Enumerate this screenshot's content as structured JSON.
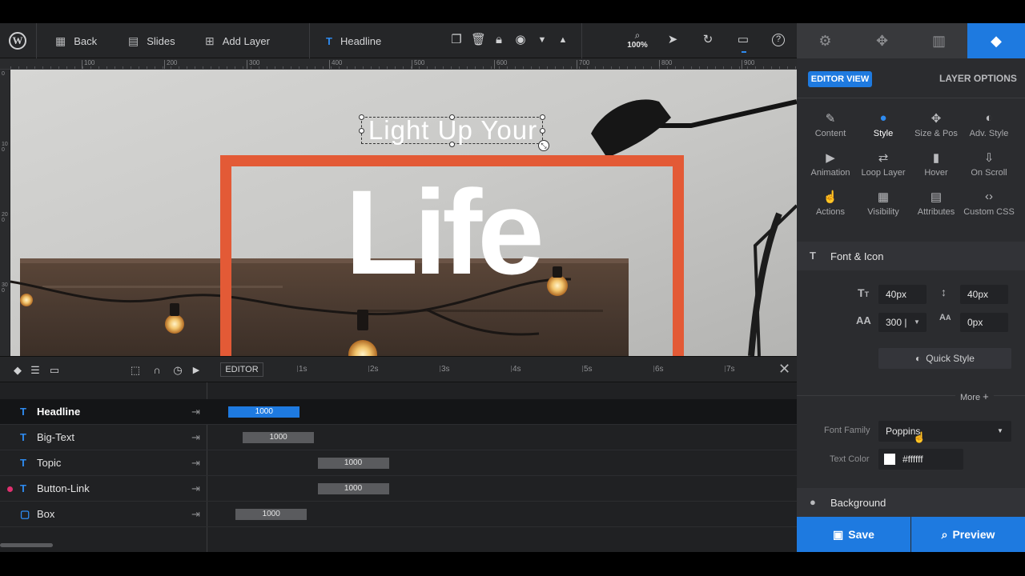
{
  "toolbar": {
    "back_label": "Back",
    "slides_label": "Slides",
    "add_layer_label": "Add Layer",
    "layer_type_glyph": "T",
    "current_layer": "Headline",
    "zoom": "100%"
  },
  "ruler": {
    "ticks": [
      "100",
      "200",
      "300",
      "400",
      "500",
      "600",
      "700",
      "800",
      "900"
    ]
  },
  "vruler": {
    "ticks": [
      "0",
      "100",
      "200",
      "300"
    ]
  },
  "canvas": {
    "headline_text": "Light Up Your",
    "big_text": "Life",
    "accent_color": "#e35a36"
  },
  "timeline": {
    "editor_label": "EDITOR",
    "time_ticks": [
      "1s",
      "2s",
      "3s",
      "4s",
      "5s",
      "6s",
      "7s"
    ],
    "layers": [
      {
        "type_glyph": "T",
        "name": "Headline",
        "duration": "1000",
        "start_s": 0.7,
        "end_s": 1.7,
        "selected": true
      },
      {
        "type_glyph": "T",
        "name": "Big-Text",
        "duration": "1000",
        "start_s": 0.9,
        "end_s": 1.9,
        "selected": false
      },
      {
        "type_glyph": "T",
        "name": "Topic",
        "duration": "1000",
        "start_s": 1.95,
        "end_s": 2.95,
        "selected": false
      },
      {
        "type_glyph": "T",
        "name": "Button-Link",
        "duration": "1000",
        "start_s": 1.95,
        "end_s": 2.95,
        "selected": false,
        "has_action": true
      },
      {
        "type_glyph": "▢",
        "name": "Box",
        "duration": "1000",
        "start_s": 0.8,
        "end_s": 1.8,
        "selected": false
      }
    ]
  },
  "panel": {
    "editor_view_label": "EDITOR VIEW",
    "layer_options_label": "LAYER OPTIONS",
    "options": [
      {
        "label": "Content",
        "icon": "pencil-icon",
        "glyph": "✎",
        "active": false
      },
      {
        "label": "Style",
        "icon": "palette-icon",
        "glyph": "●",
        "active": true
      },
      {
        "label": "Size & Pos",
        "icon": "move-icon",
        "glyph": "✥",
        "active": false
      },
      {
        "label": "Adv. Style",
        "icon": "contrast-icon",
        "glyph": "◐",
        "active": false
      },
      {
        "label": "Animation",
        "icon": "play-icon",
        "glyph": "▶",
        "active": false
      },
      {
        "label": "Loop Layer",
        "icon": "repeat-icon",
        "glyph": "⇄",
        "active": false
      },
      {
        "label": "Hover",
        "icon": "mouse-icon",
        "glyph": "▮",
        "active": false
      },
      {
        "label": "On Scroll",
        "icon": "scroll-icon",
        "glyph": "⇩",
        "active": false
      },
      {
        "label": "Actions",
        "icon": "pointer-icon",
        "glyph": "☝",
        "active": false
      },
      {
        "label": "Visibility",
        "icon": "visibility-icon",
        "glyph": "▦",
        "active": false
      },
      {
        "label": "Attributes",
        "icon": "document-icon",
        "glyph": "▤",
        "active": false
      },
      {
        "label": "Custom CSS",
        "icon": "code-icon",
        "glyph": "‹›",
        "active": false
      }
    ],
    "font_section_label": "Font & Icon",
    "font_size": "40px",
    "line_height": "40px",
    "font_weight": "300 |",
    "letter_spacing": "0px",
    "quick_style_label": "Quick Style",
    "more_label": "More",
    "font_family_label": "Font Family",
    "font_family_value": "Poppins",
    "text_color_label": "Text Color",
    "text_color_value": "#ffffff",
    "background_label": "Background",
    "save_label": "Save",
    "preview_label": "Preview",
    "brand_color": "#1e7ae0"
  }
}
